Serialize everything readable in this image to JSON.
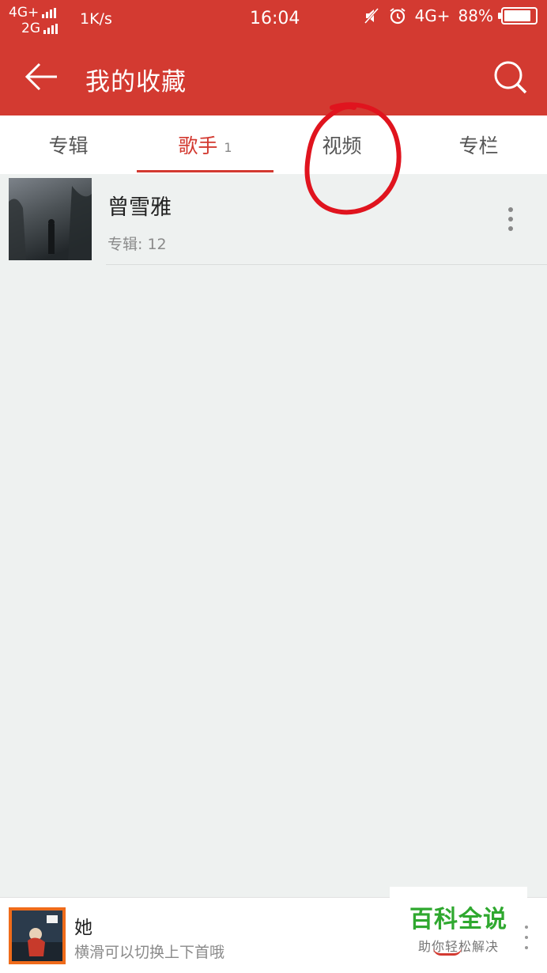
{
  "status_bar": {
    "network_top": "4G+",
    "network_bottom": "2G",
    "speed": "1K/s",
    "time": "16:04",
    "network_right": "4G+",
    "battery": "88%",
    "battery_level": 0.88
  },
  "header": {
    "title": "我的收藏",
    "back_icon": "arrow-left-icon",
    "search_icon": "search-icon"
  },
  "tabs": [
    {
      "label": "专辑",
      "count": ""
    },
    {
      "label": "歌手",
      "count": "1"
    },
    {
      "label": "视频",
      "count": ""
    },
    {
      "label": "专栏",
      "count": ""
    }
  ],
  "active_tab": 1,
  "artists": [
    {
      "name": "曾雪雅",
      "meta": "专辑: 12"
    }
  ],
  "player": {
    "title": "她",
    "subtitle": "横滑可以切换上下首哦"
  },
  "watermark": {
    "main": "百科全说",
    "sub": "助你轻松解决"
  },
  "colors": {
    "brand": "#d33a31",
    "background": "#eef1f0",
    "watermark_green": "#2fa82f",
    "annotation_red": "#e0141e"
  }
}
